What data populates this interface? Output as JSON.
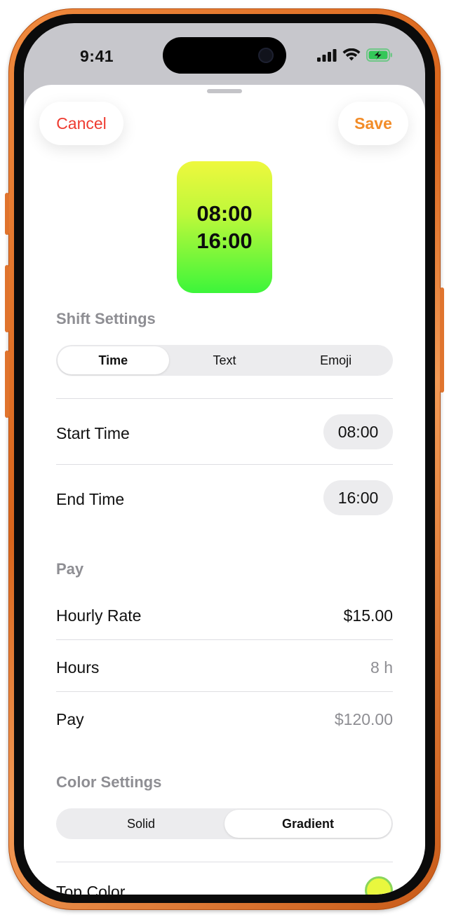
{
  "status_bar": {
    "time": "9:41",
    "icons": [
      "cellular-signal-icon",
      "wifi-icon",
      "battery-charging-icon"
    ]
  },
  "header": {
    "cancel_label": "Cancel",
    "save_label": "Save"
  },
  "preview": {
    "start": "08:00",
    "end": "16:00",
    "gradient_top": "#eef83e",
    "gradient_bottom": "#3cf53a"
  },
  "shift_settings": {
    "title": "Shift Settings",
    "modes": [
      "Time",
      "Text",
      "Emoji"
    ],
    "selected_mode": "Time",
    "start_time_label": "Start Time",
    "start_time_value": "08:00",
    "end_time_label": "End Time",
    "end_time_value": "16:00"
  },
  "pay": {
    "title": "Pay",
    "hourly_rate_label": "Hourly Rate",
    "hourly_rate_value": "$15.00",
    "hours_label": "Hours",
    "hours_value": "8 h",
    "pay_label": "Pay",
    "pay_value": "$120.00"
  },
  "color_settings": {
    "title": "Color Settings",
    "modes": [
      "Solid",
      "Gradient"
    ],
    "selected_mode": "Gradient",
    "top_color_label": "Top Color",
    "top_color_value": "#e9f73e"
  },
  "colors": {
    "cancel": "#ee3b30",
    "save": "#f28c28",
    "frame": "#e0742e"
  }
}
